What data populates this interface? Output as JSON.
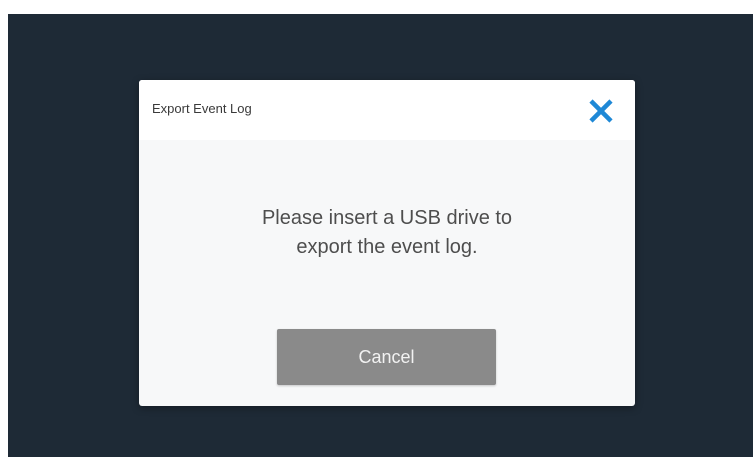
{
  "dialog": {
    "title": "Export Event Log",
    "close_icon": "close-x-icon",
    "message_line1": "Please insert a USB drive to",
    "message_line2": "export the event log.",
    "cancel_label": "Cancel"
  },
  "colors": {
    "screen_background": "#1e2a36",
    "dialog_background": "#f7f8f9",
    "close_icon": "#1e88d6",
    "cancel_button": "#8a8a8a"
  }
}
